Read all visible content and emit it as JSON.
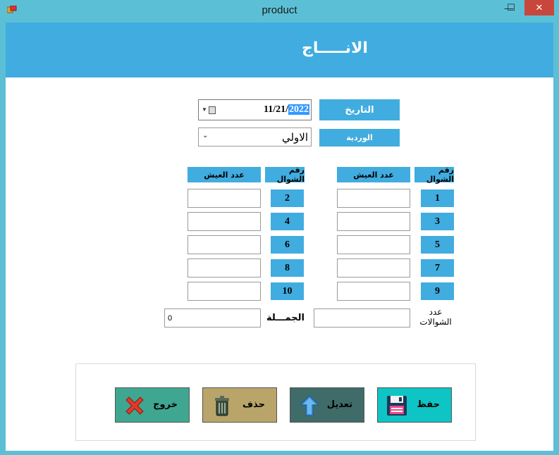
{
  "window": {
    "title": "product",
    "minimize_label": "—",
    "maximize_label": "☐",
    "close_label": "✕"
  },
  "header": {
    "title": "الانـــــاج"
  },
  "form": {
    "date_label": "التاريخ",
    "date_value_prefix": "11/21/",
    "date_value_year": "2022",
    "shift_label": "الوردية",
    "shift_value": "الاولي"
  },
  "grid": {
    "right": {
      "no_header": "رقم الشوال",
      "count_header": "عدد العيش",
      "rows": [
        "1",
        "3",
        "5",
        "7",
        "9"
      ]
    },
    "left": {
      "no_header": "رقم الشوال",
      "count_header": "عدد العيش",
      "rows": [
        "2",
        "4",
        "6",
        "8",
        "10"
      ]
    }
  },
  "summary": {
    "count_label_line1": "عدد",
    "count_label_line2": "الشوالات",
    "count_value": "",
    "total_label": "الجمـــلة",
    "total_value": "0"
  },
  "buttons": {
    "save": "حفظ",
    "edit": "تعديل",
    "delete": "حذف",
    "exit": "خروج"
  },
  "colors": {
    "accent": "#41acdf",
    "titlebar": "#5bc0d6",
    "save": "#0fc4c4",
    "edit": "#3f6b68",
    "delete": "#b9a56a",
    "exit": "#3fa791"
  }
}
